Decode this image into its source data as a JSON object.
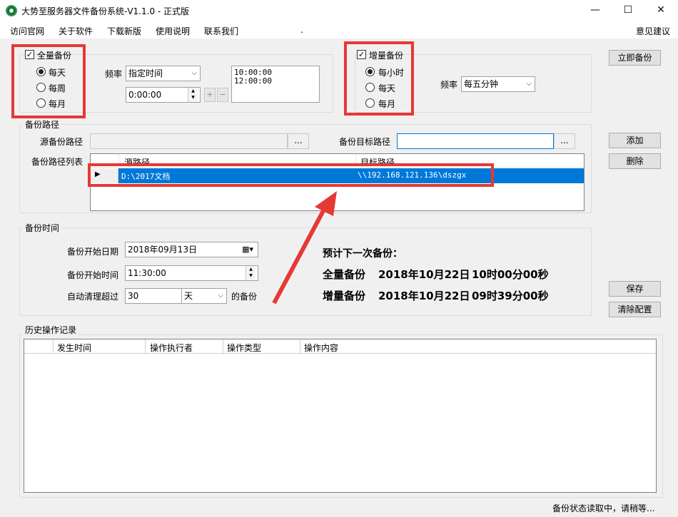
{
  "window": {
    "title": "大势至服务器文件备份系统-V1.1.0 - 正式版",
    "minimize": "—",
    "maximize": "☐",
    "close": "✕"
  },
  "menu": {
    "items": [
      "访问官网",
      "关于软件",
      "下载新版",
      "使用说明",
      "联系我们"
    ],
    "dot": ".",
    "feedback": "意见建议"
  },
  "full_backup": {
    "label": "全量备份",
    "checked": true,
    "options": [
      "每天",
      "每周",
      "每月"
    ],
    "selected_index": 0,
    "freq_label": "频率",
    "freq_value": "指定时间",
    "time_value": "0:00:00",
    "add_symbol": "+",
    "remove_symbol": "−",
    "times": [
      "10:00:00",
      "12:00:00"
    ]
  },
  "incremental_backup": {
    "label": "增量备份",
    "checked": true,
    "options": [
      "每小时",
      "每天",
      "每月"
    ],
    "selected_index": 0,
    "freq_label": "频率",
    "freq_value": "每五分钟"
  },
  "actions": {
    "backup_now": "立即备份",
    "add": "添加",
    "delete": "删除",
    "save": "保存",
    "clear_config": "清除配置"
  },
  "backup_path": {
    "group_title": "备份路径",
    "source_label": "源备份路径",
    "source_value": "",
    "browse": "...",
    "target_label": "备份目标路径",
    "target_value": "",
    "list_label": "备份路径列表",
    "columns": [
      "源路径",
      "目标路径"
    ],
    "rows": [
      {
        "source": "D:\\2017文档",
        "target": "\\\\192.168.121.136\\dszgx"
      }
    ]
  },
  "backup_time": {
    "group_title": "备份时间",
    "start_date_label": "备份开始日期",
    "start_date": "2018年09月13日",
    "start_time_label": "备份开始时间",
    "start_time": "11:30:00",
    "auto_clean_label": "自动清理超过",
    "auto_clean_value": "30",
    "auto_clean_unit": "天",
    "auto_clean_suffix": "的备份"
  },
  "next_backup": {
    "title": "预计下一次备份：",
    "full_label": "全量备份",
    "full_date": "2018年10月22日",
    "full_time": "10时00分00秒",
    "inc_label": "增量备份",
    "inc_date": "2018年10月22日",
    "inc_time": "09时39分00秒"
  },
  "history": {
    "group_title": "历史操作记录",
    "columns": [
      "发生时间",
      "操作执行者",
      "操作类型",
      "操作内容"
    ]
  },
  "status": {
    "text": "备份状态读取中，请稍等..."
  },
  "colors": {
    "highlight": "#e53935",
    "selection": "#0078d7"
  }
}
